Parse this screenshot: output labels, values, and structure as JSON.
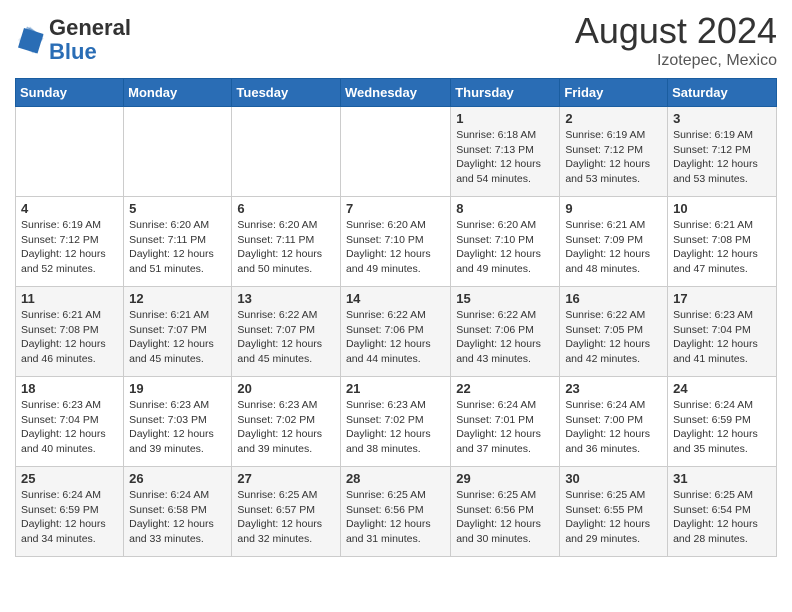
{
  "header": {
    "logo_general": "General",
    "logo_blue": "Blue",
    "month_year": "August 2024",
    "location": "Izotepec, Mexico"
  },
  "days_of_week": [
    "Sunday",
    "Monday",
    "Tuesday",
    "Wednesday",
    "Thursday",
    "Friday",
    "Saturday"
  ],
  "weeks": [
    [
      {
        "day": "",
        "info": ""
      },
      {
        "day": "",
        "info": ""
      },
      {
        "day": "",
        "info": ""
      },
      {
        "day": "",
        "info": ""
      },
      {
        "day": "1",
        "sunrise": "6:18 AM",
        "sunset": "7:13 PM",
        "daylight": "12 hours and 54 minutes."
      },
      {
        "day": "2",
        "sunrise": "6:19 AM",
        "sunset": "7:12 PM",
        "daylight": "12 hours and 53 minutes."
      },
      {
        "day": "3",
        "sunrise": "6:19 AM",
        "sunset": "7:12 PM",
        "daylight": "12 hours and 53 minutes."
      }
    ],
    [
      {
        "day": "4",
        "sunrise": "6:19 AM",
        "sunset": "7:12 PM",
        "daylight": "12 hours and 52 minutes."
      },
      {
        "day": "5",
        "sunrise": "6:20 AM",
        "sunset": "7:11 PM",
        "daylight": "12 hours and 51 minutes."
      },
      {
        "day": "6",
        "sunrise": "6:20 AM",
        "sunset": "7:11 PM",
        "daylight": "12 hours and 50 minutes."
      },
      {
        "day": "7",
        "sunrise": "6:20 AM",
        "sunset": "7:10 PM",
        "daylight": "12 hours and 49 minutes."
      },
      {
        "day": "8",
        "sunrise": "6:20 AM",
        "sunset": "7:10 PM",
        "daylight": "12 hours and 49 minutes."
      },
      {
        "day": "9",
        "sunrise": "6:21 AM",
        "sunset": "7:09 PM",
        "daylight": "12 hours and 48 minutes."
      },
      {
        "day": "10",
        "sunrise": "6:21 AM",
        "sunset": "7:08 PM",
        "daylight": "12 hours and 47 minutes."
      }
    ],
    [
      {
        "day": "11",
        "sunrise": "6:21 AM",
        "sunset": "7:08 PM",
        "daylight": "12 hours and 46 minutes."
      },
      {
        "day": "12",
        "sunrise": "6:21 AM",
        "sunset": "7:07 PM",
        "daylight": "12 hours and 45 minutes."
      },
      {
        "day": "13",
        "sunrise": "6:22 AM",
        "sunset": "7:07 PM",
        "daylight": "12 hours and 45 minutes."
      },
      {
        "day": "14",
        "sunrise": "6:22 AM",
        "sunset": "7:06 PM",
        "daylight": "12 hours and 44 minutes."
      },
      {
        "day": "15",
        "sunrise": "6:22 AM",
        "sunset": "7:06 PM",
        "daylight": "12 hours and 43 minutes."
      },
      {
        "day": "16",
        "sunrise": "6:22 AM",
        "sunset": "7:05 PM",
        "daylight": "12 hours and 42 minutes."
      },
      {
        "day": "17",
        "sunrise": "6:23 AM",
        "sunset": "7:04 PM",
        "daylight": "12 hours and 41 minutes."
      }
    ],
    [
      {
        "day": "18",
        "sunrise": "6:23 AM",
        "sunset": "7:04 PM",
        "daylight": "12 hours and 40 minutes."
      },
      {
        "day": "19",
        "sunrise": "6:23 AM",
        "sunset": "7:03 PM",
        "daylight": "12 hours and 39 minutes."
      },
      {
        "day": "20",
        "sunrise": "6:23 AM",
        "sunset": "7:02 PM",
        "daylight": "12 hours and 39 minutes."
      },
      {
        "day": "21",
        "sunrise": "6:23 AM",
        "sunset": "7:02 PM",
        "daylight": "12 hours and 38 minutes."
      },
      {
        "day": "22",
        "sunrise": "6:24 AM",
        "sunset": "7:01 PM",
        "daylight": "12 hours and 37 minutes."
      },
      {
        "day": "23",
        "sunrise": "6:24 AM",
        "sunset": "7:00 PM",
        "daylight": "12 hours and 36 minutes."
      },
      {
        "day": "24",
        "sunrise": "6:24 AM",
        "sunset": "6:59 PM",
        "daylight": "12 hours and 35 minutes."
      }
    ],
    [
      {
        "day": "25",
        "sunrise": "6:24 AM",
        "sunset": "6:59 PM",
        "daylight": "12 hours and 34 minutes."
      },
      {
        "day": "26",
        "sunrise": "6:24 AM",
        "sunset": "6:58 PM",
        "daylight": "12 hours and 33 minutes."
      },
      {
        "day": "27",
        "sunrise": "6:25 AM",
        "sunset": "6:57 PM",
        "daylight": "12 hours and 32 minutes."
      },
      {
        "day": "28",
        "sunrise": "6:25 AM",
        "sunset": "6:56 PM",
        "daylight": "12 hours and 31 minutes."
      },
      {
        "day": "29",
        "sunrise": "6:25 AM",
        "sunset": "6:56 PM",
        "daylight": "12 hours and 30 minutes."
      },
      {
        "day": "30",
        "sunrise": "6:25 AM",
        "sunset": "6:55 PM",
        "daylight": "12 hours and 29 minutes."
      },
      {
        "day": "31",
        "sunrise": "6:25 AM",
        "sunset": "6:54 PM",
        "daylight": "12 hours and 28 minutes."
      }
    ]
  ]
}
